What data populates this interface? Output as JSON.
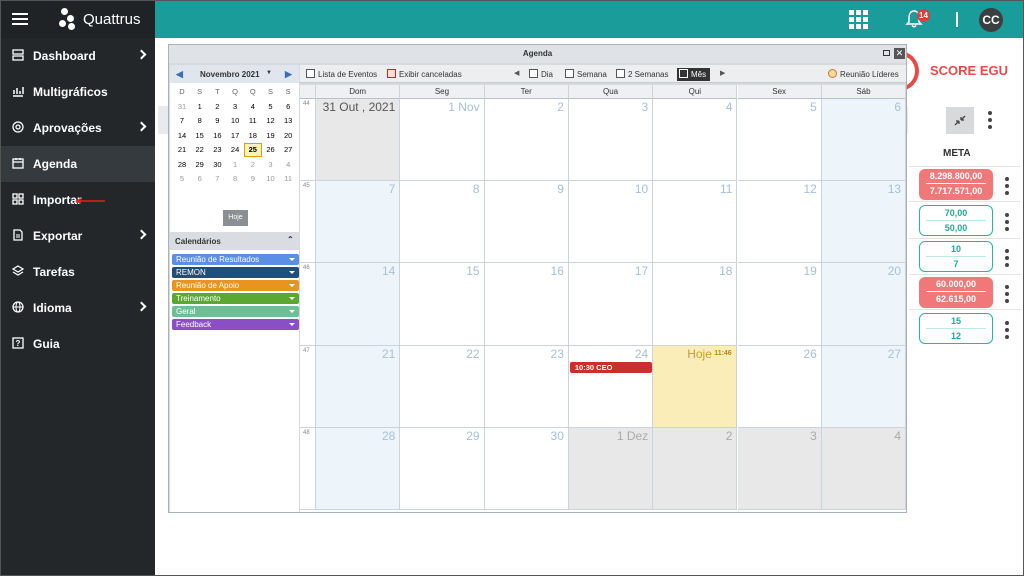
{
  "app": {
    "brand": "Quattrus",
    "notifications_count": "14",
    "user_initials": "CC",
    "icons": {
      "menu": "hamburger-icon",
      "apps": "apps-grid-icon",
      "notifications": "bell-icon"
    }
  },
  "sidebar": {
    "items": [
      {
        "label": "Dashboard",
        "icon": "dashboard-icon",
        "has_submenu": true
      },
      {
        "label": "Multigráficos",
        "icon": "chart-icon",
        "has_submenu": false
      },
      {
        "label": "Aprovações",
        "icon": "target-icon",
        "has_submenu": true
      },
      {
        "label": "Agenda",
        "icon": "calendar-icon",
        "has_submenu": false,
        "active": true
      },
      {
        "label": "Importar",
        "icon": "import-icon",
        "has_submenu": false
      },
      {
        "label": "Exportar",
        "icon": "export-icon",
        "has_submenu": true
      },
      {
        "label": "Tarefas",
        "icon": "layers-icon",
        "has_submenu": false
      },
      {
        "label": "Idioma",
        "icon": "globe-icon",
        "has_submenu": true
      },
      {
        "label": "Guia",
        "icon": "help-icon",
        "has_submenu": false
      }
    ]
  },
  "background": {
    "score_label": "SCORE EGU",
    "meta_header": "META",
    "meta_rows": [
      {
        "top": "8.298.800,00",
        "bottom": "7.717.571,00",
        "status": "red"
      },
      {
        "top": "70,00",
        "bottom": "50,00",
        "status": "green"
      },
      {
        "top": "10",
        "bottom": "7",
        "status": "green"
      },
      {
        "top": "60.000,00",
        "bottom": "62.615,00",
        "status": "red"
      },
      {
        "top": "15",
        "bottom": "12",
        "status": "green"
      }
    ]
  },
  "agenda": {
    "title": "Agenda",
    "mini_calendar": {
      "month_label": "Novembro 2021",
      "weekday_headers": [
        "D",
        "S",
        "T",
        "Q",
        "Q",
        "S",
        "S"
      ],
      "weeks": [
        [
          "31",
          "1",
          "2",
          "3",
          "4",
          "5",
          "6"
        ],
        [
          "7",
          "8",
          "9",
          "10",
          "11",
          "12",
          "13"
        ],
        [
          "14",
          "15",
          "16",
          "17",
          "18",
          "19",
          "20"
        ],
        [
          "21",
          "22",
          "23",
          "24",
          "25",
          "26",
          "27"
        ],
        [
          "28",
          "29",
          "30",
          "1",
          "2",
          "3",
          "4"
        ],
        [
          "5",
          "6",
          "7",
          "8",
          "9",
          "10",
          "11"
        ]
      ],
      "selected_day": "25",
      "today_button": "Hoje"
    },
    "calendars_header": "Calendários",
    "calendars": [
      {
        "label": "Reunião de Resultados",
        "color": "#5b8ee6"
      },
      {
        "label": "REMON",
        "color": "#1f4e79"
      },
      {
        "label": "Reunião de Apoio",
        "color": "#e8941f"
      },
      {
        "label": "Treinamento",
        "color": "#5aa832"
      },
      {
        "label": "Geral",
        "color": "#6dbf95"
      },
      {
        "label": "Feedback",
        "color": "#8a4fc4"
      }
    ],
    "toolbar": {
      "event_list": "Lista de Eventos",
      "show_cancelled": "Exibir canceladas",
      "day": "Dia",
      "week": "Semana",
      "two_weeks": "2 Semanas",
      "month": "Mês",
      "meeting": "Reunião Líderes"
    },
    "day_headers": [
      "Dom",
      "Seg",
      "Ter",
      "Qua",
      "Qui",
      "Sex",
      "Sáb"
    ],
    "week_numbers": [
      "44",
      "45",
      "46",
      "47",
      "48"
    ],
    "weeks": [
      [
        "31 Out , 2021",
        "1 Nov",
        "2",
        "3",
        "4",
        "5",
        "6"
      ],
      [
        "7",
        "8",
        "9",
        "10",
        "11",
        "12",
        "13"
      ],
      [
        "14",
        "15",
        "16",
        "17",
        "18",
        "19",
        "20"
      ],
      [
        "21",
        "22",
        "23",
        "24",
        "Hoje",
        "26",
        "27"
      ],
      [
        "28",
        "29",
        "30",
        "1 Dez",
        "2",
        "3",
        "4"
      ]
    ],
    "today_time": "11:46",
    "event": {
      "label": "10:30 CEO",
      "color": "#c9302c"
    }
  }
}
